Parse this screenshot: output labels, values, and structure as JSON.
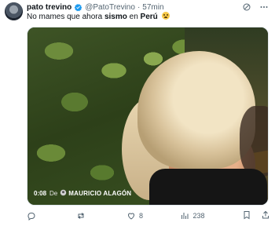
{
  "tweet": {
    "author": "pato trevino",
    "handle": "@PatoTrevino",
    "separator": "·",
    "time": "57min",
    "text": {
      "part1": "No mames que ahora ",
      "bold1": "sismo",
      "part2": " en ",
      "bold2": "Perú",
      "emoji": "crying-laughing-emoji"
    }
  },
  "media": {
    "timestamp": "0:08",
    "de_label": "De",
    "source_author": "MAURICIO ALAGÓN"
  },
  "actions": {
    "reply_count": "",
    "retweet_count": "",
    "like_count": "8",
    "views_count": "238"
  },
  "colors": {
    "verified_blue": "#1d9bf0",
    "muted_text": "#536471"
  }
}
